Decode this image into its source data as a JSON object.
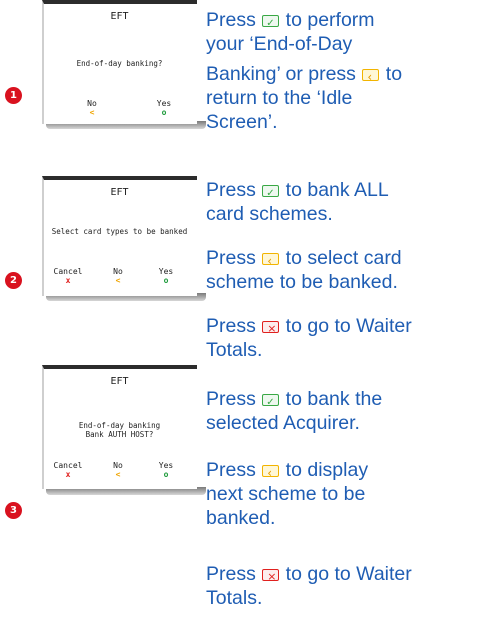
{
  "steps": [
    {
      "badge": "1",
      "screen": {
        "title": "EFT",
        "message_lines": [
          "End-of-day banking?"
        ],
        "buttons": [
          {
            "label": "No",
            "symbol": "<"
          },
          {
            "label": "Yes",
            "symbol": "o"
          }
        ]
      },
      "instructions": [
        {
          "parts": [
            "Press ",
            " to perform",
            "your ‘End-of-Day",
            "Banking’ or press ",
            " to",
            "return to the ‘Idle",
            "Screen’."
          ]
        }
      ]
    },
    {
      "badge": "2",
      "screen": {
        "title": "EFT",
        "message_lines": [
          "Select card types to be banked"
        ],
        "buttons": [
          {
            "label": "Cancel",
            "symbol": "x"
          },
          {
            "label": "No",
            "symbol": "<"
          },
          {
            "label": "Yes",
            "symbol": "o"
          }
        ]
      },
      "instructions": [
        {
          "parts": [
            "Press ",
            " to bank ALL",
            "card schemes."
          ]
        },
        {
          "parts": [
            "Press ",
            " to select card",
            "scheme to be banked."
          ]
        },
        {
          "parts": [
            "Press ",
            " to go to Waiter",
            "Totals."
          ]
        }
      ]
    },
    {
      "badge": "3",
      "screen": {
        "title": "EFT",
        "message_lines": [
          "End-of-day banking",
          "Bank AUTH HOST?"
        ],
        "buttons": [
          {
            "label": "Cancel",
            "symbol": "x"
          },
          {
            "label": "No",
            "symbol": "<"
          },
          {
            "label": "Yes",
            "symbol": "o"
          }
        ]
      },
      "instructions": [
        {
          "parts": [
            "Press ",
            " to bank the",
            "selected Acquirer."
          ]
        },
        {
          "parts": [
            "Press ",
            " to display",
            "next scheme to be",
            "banked."
          ]
        },
        {
          "parts": [
            "Press ",
            " to go to Waiter",
            "Totals."
          ]
        }
      ]
    }
  ],
  "icons": {
    "confirm_key": "green-confirm-key-icon",
    "back_key": "yellow-back-key-icon",
    "cancel_key": "red-cancel-key-icon"
  },
  "colors": {
    "text_blue": "#1f5db3",
    "badge_red": "#d9121f",
    "cancel_red": "#e0201e",
    "back_yellow": "#f0a500",
    "ok_green": "#1c9a3a"
  }
}
